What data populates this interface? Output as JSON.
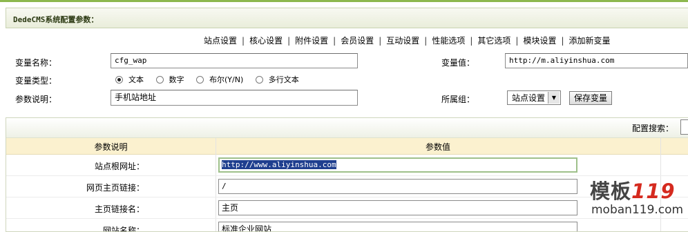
{
  "header": {
    "title": "DedeCMS系统配置参数："
  },
  "tabs": [
    {
      "label": "站点设置"
    },
    {
      "label": "核心设置"
    },
    {
      "label": "附件设置"
    },
    {
      "label": "会员设置"
    },
    {
      "label": "互动设置"
    },
    {
      "label": "性能选项"
    },
    {
      "label": "其它选项"
    },
    {
      "label": "模块设置"
    },
    {
      "label": "添加新变量"
    }
  ],
  "form": {
    "var_name_label": "变量名称：",
    "var_name_value": "cfg_wap",
    "var_value_label": "变量值：",
    "var_value_value": "http://m.aliyinshua.com",
    "var_type_label": "变量类型：",
    "var_types": [
      {
        "label": "文本",
        "checked": true
      },
      {
        "label": "数字",
        "checked": false
      },
      {
        "label": "布尔(Y/N)",
        "checked": false
      },
      {
        "label": "多行文本",
        "checked": false
      }
    ],
    "desc_label": "参数说明：",
    "desc_value": "手机站地址",
    "group_label": "所属组：",
    "group_value": "站点设置",
    "save_button": "保存变量"
  },
  "table": {
    "search_label": "配置搜索：",
    "columns": [
      "参数说明",
      "参数值"
    ],
    "rows": [
      {
        "label": "站点根网址：",
        "value": "http://www.aliyinshua.com"
      },
      {
        "label": "网页主页链接：",
        "value": "/"
      },
      {
        "label": "主页链接名：",
        "value": "主页"
      },
      {
        "label": "网站名称：",
        "value": "标准企业网站"
      }
    ]
  },
  "watermark": {
    "main": "模板",
    "number": "119",
    "sub": "moban119.com"
  },
  "colors": {
    "accent": "#8cb84e",
    "header_row": "#fbf1cf",
    "selection": "#1f3f8f"
  }
}
